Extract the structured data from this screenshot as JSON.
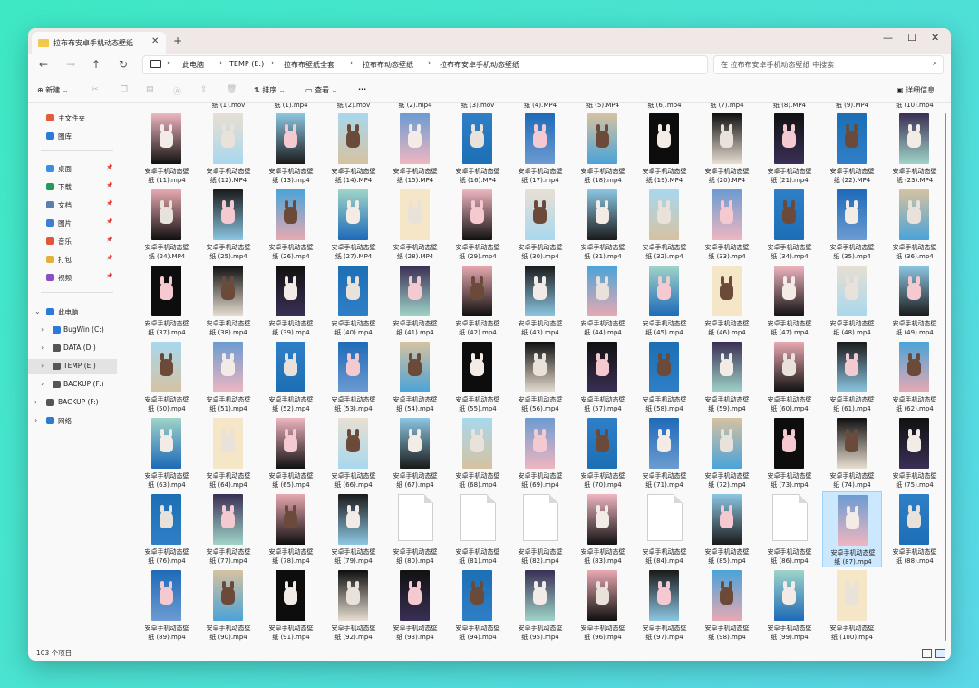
{
  "window": {
    "tab_title": "拉布布安卓手机动态壁纸",
    "close_glyph": "✕",
    "new_tab_glyph": "+",
    "controls": [
      "—",
      "☐",
      "✕"
    ]
  },
  "nav": {
    "back": "←",
    "forward": "→",
    "up": "↑",
    "refresh": "↻"
  },
  "breadcrumb": [
    "此电脑",
    "TEMP (E:)",
    "拉布布壁纸全套",
    "拉布布动态壁纸",
    "拉布布安卓手机动态壁纸"
  ],
  "search": {
    "placeholder": "在 拉布布安卓手机动态壁纸 中搜索"
  },
  "toolbar": {
    "new": "新建",
    "sort": "排序",
    "view": "查看",
    "more": "···",
    "details": "详细信息"
  },
  "sidebar": {
    "quick": [
      {
        "label": "主文件夹",
        "color": "#e35d3c"
      },
      {
        "label": "图库",
        "color": "#2b7bd6"
      }
    ],
    "pinned": [
      {
        "label": "桌面",
        "color": "#3a8ee6"
      },
      {
        "label": "下载",
        "color": "#1e9e5a"
      },
      {
        "label": "文档",
        "color": "#5a7fb0"
      },
      {
        "label": "图片",
        "color": "#3b7fd4"
      },
      {
        "label": "音乐",
        "color": "#e0573a"
      },
      {
        "label": "打包",
        "color": "#e3b23c"
      },
      {
        "label": "视频",
        "color": "#8a4fc7"
      }
    ],
    "this_pc": "此电脑",
    "drives": [
      "BugWin (C:)",
      "DATA (D:)",
      "TEMP (E:)",
      "BACKUP (F:)"
    ],
    "backup2": "BACKUP (F:)",
    "network": "网络"
  },
  "top_partial_names": [
    "纸 (1).mov",
    "纸 (1).mp4",
    "纸 (2).mov",
    "纸 (2).mp4",
    "纸 (3).mov",
    "纸 (4).MP4",
    "纸 (5).MP4",
    "纸 (6).mp4",
    "纸 (7).mp4",
    "纸 (8).MP4",
    "纸 (9).MP4",
    "纸 (10).mp4"
  ],
  "file_prefix": "安卓手机动态壁",
  "files": [
    "纸 (11).mp4",
    "纸 (12).MP4",
    "纸 (13).mp4",
    "纸 (14).MP4",
    "纸 (15).MP4",
    "纸 (16).MP4",
    "纸 (17).mp4",
    "纸 (18).mp4",
    "纸 (19).MP4",
    "纸 (20).MP4",
    "纸 (21).mp4",
    "纸 (22).MP4",
    "纸 (23).MP4",
    "纸 (24).MP4",
    "纸 (25).mp4",
    "纸 (26).mp4",
    "纸 (27).MP4",
    "纸 (28).MP4",
    "纸 (29).mp4",
    "纸 (30).mp4",
    "纸 (31).mp4",
    "纸 (32).mp4",
    "纸 (33).mp4",
    "纸 (34).mp4",
    "纸 (35).mp4",
    "纸 (36).mp4",
    "纸 (37).mp4",
    "纸 (38).mp4",
    "纸 (39).mp4",
    "纸 (40).mp4",
    "纸 (41).mp4",
    "纸 (42).mp4",
    "纸 (43).mp4",
    "纸 (44).mp4",
    "纸 (45).mp4",
    "纸 (46).mp4",
    "纸 (47).mp4",
    "纸 (48).mp4",
    "纸 (49).mp4",
    "纸 (50).mp4",
    "纸 (51).mp4",
    "纸 (52).mp4",
    "纸 (53).mp4",
    "纸 (54).mp4",
    "纸 (55).mp4",
    "纸 (56).mp4",
    "纸 (57).mp4",
    "纸 (58).mp4",
    "纸 (59).mp4",
    "纸 (60).mp4",
    "纸 (61).mp4",
    "纸 (62).mp4",
    "纸 (63).mp4",
    "纸 (64).mp4",
    "纸 (65).mp4",
    "纸 (66).mp4",
    "纸 (67).mp4",
    "纸 (68).mp4",
    "纸 (69).mp4",
    "纸 (70).mp4",
    "纸 (71).mp4",
    "纸 (72).mp4",
    "纸 (73).mp4",
    "纸 (74).mp4",
    "纸 (75).mp4",
    "纸 (76).mp4",
    "纸 (77).mp4",
    "纸 (78).mp4",
    "纸 (79).mp4",
    "纸 (80).mp4",
    "纸 (81).mp4",
    "纸 (82).mp4",
    "纸 (83).mp4",
    "纸 (84).mp4",
    "纸 (85).mp4",
    "纸 (86).mp4",
    "纸 (87).mp4",
    "纸 (88).mp4",
    "纸 (89).mp4",
    "纸 (90).mp4",
    "纸 (91).mp4",
    "纸 (92).mp4",
    "纸 (93).mp4",
    "纸 (94).mp4",
    "纸 (95).mp4",
    "纸 (96).mp4",
    "纸 (97).mp4",
    "纸 (98).mp4",
    "纸 (99).mp4",
    "纸 (100).mp4"
  ],
  "no_thumbnail_files": [
    "纸 (80).mp4",
    "纸 (81).mp4",
    "纸 (82).mp4",
    "纸 (84).mp4",
    "纸 (86).mp4"
  ],
  "selected_file": "纸 (87).mp4",
  "thumb_palette": [
    "#4aa3d8",
    "#111111",
    "#2f7fc6",
    "#f0b6c0",
    "#e8a9b1",
    "#0d0d0d",
    "#a8d8ee",
    "#9fd4c8",
    "#1c6fb5",
    "#1e6ab8",
    "#e8dfd2",
    "#1a1a1a",
    "#0f0f0f",
    "#6c9bd1",
    "#f5e6c8",
    "#3a2f55",
    "#d6c2a0",
    "#8cc7e3"
  ],
  "status": {
    "count": "103 个项目"
  }
}
